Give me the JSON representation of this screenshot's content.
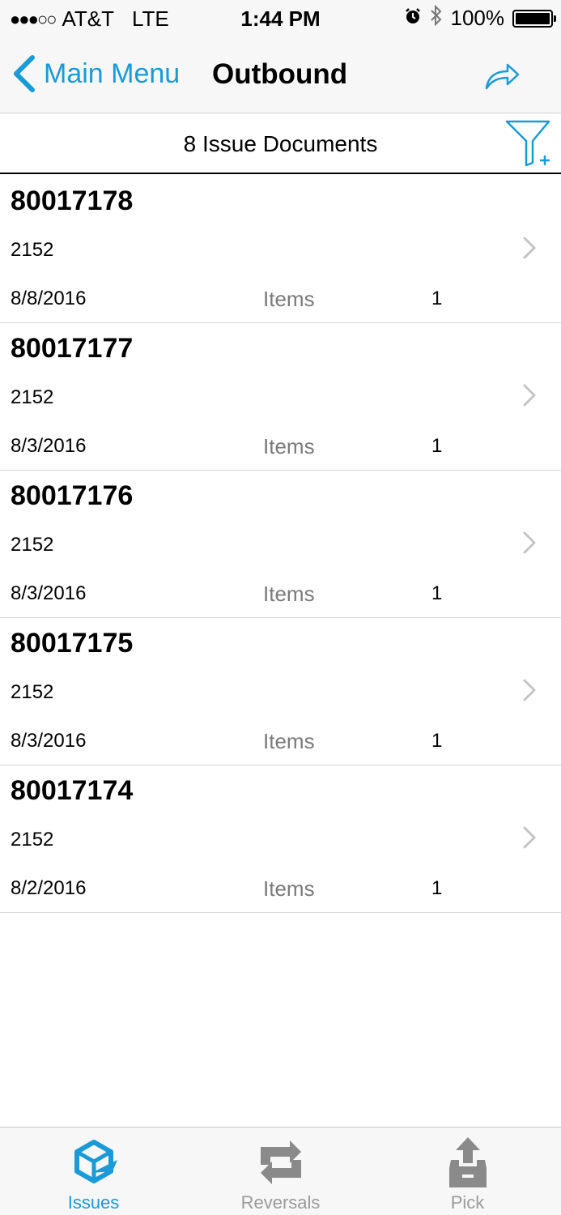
{
  "status_bar": {
    "signal": "●●●○○",
    "carrier": "AT&T",
    "network": "LTE",
    "time": "1:44 PM",
    "battery": "100%"
  },
  "nav": {
    "back_label": "Main Menu",
    "title": "Outbound"
  },
  "header": {
    "count_text": "8 Issue Documents"
  },
  "documents": [
    {
      "id": "80017178",
      "code": "2152",
      "date": "8/8/2016",
      "items_label": "Items",
      "items": "1"
    },
    {
      "id": "80017177",
      "code": "2152",
      "date": "8/3/2016",
      "items_label": "Items",
      "items": "1"
    },
    {
      "id": "80017176",
      "code": "2152",
      "date": "8/3/2016",
      "items_label": "Items",
      "items": "1"
    },
    {
      "id": "80017175",
      "code": "2152",
      "date": "8/3/2016",
      "items_label": "Items",
      "items": "1"
    },
    {
      "id": "80017174",
      "code": "2152",
      "date": "8/2/2016",
      "items_label": "Items",
      "items": "1"
    }
  ],
  "tabs": [
    {
      "label": "Issues",
      "icon": "issues-icon",
      "active": true
    },
    {
      "label": "Reversals",
      "icon": "reversals-icon",
      "active": false
    },
    {
      "label": "Pick",
      "icon": "pick-icon",
      "active": false
    }
  ],
  "colors": {
    "accent": "#1a9ad6",
    "inactive": "#9a9a9a",
    "bar_background": "#f7f7f7"
  }
}
